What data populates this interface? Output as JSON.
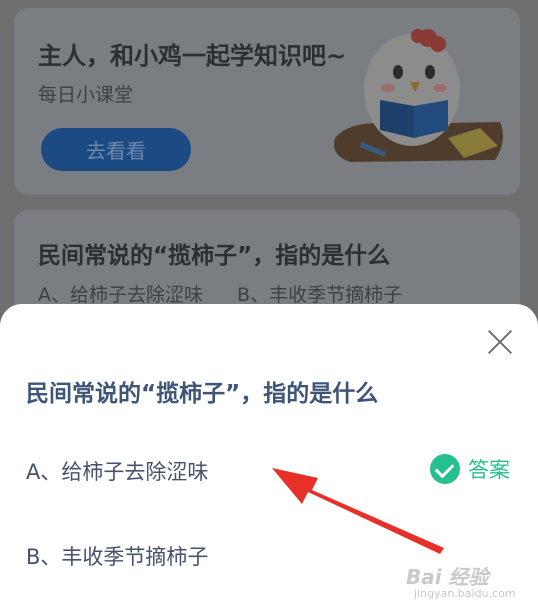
{
  "background_card_1": {
    "title": "主人，和小鸡一起学知识吧~",
    "subtitle": "每日小课堂",
    "button_label": "去看看"
  },
  "background_card_2": {
    "title": "民间常说的“揽柿子”，指的是什么",
    "options": [
      "A、给柿子去除涩味",
      "B、丰收季节摘柿子"
    ]
  },
  "sheet": {
    "question": "民间常说的“揽柿子”，指的是什么",
    "option_a": "A、给柿子去除涩味",
    "option_b": "B、丰收季节摘柿子",
    "answer_label": "答案",
    "close_icon": "close-icon",
    "answer_icon": "check-circle-icon"
  },
  "watermark": {
    "logo": "Bai 经验",
    "site": "jingyan.baidu.com"
  },
  "colors": {
    "accent_green": "#24c08d",
    "question_text": "#3f5577",
    "arrow_red": "#e8302a",
    "dim_button": "#1c4a82"
  }
}
